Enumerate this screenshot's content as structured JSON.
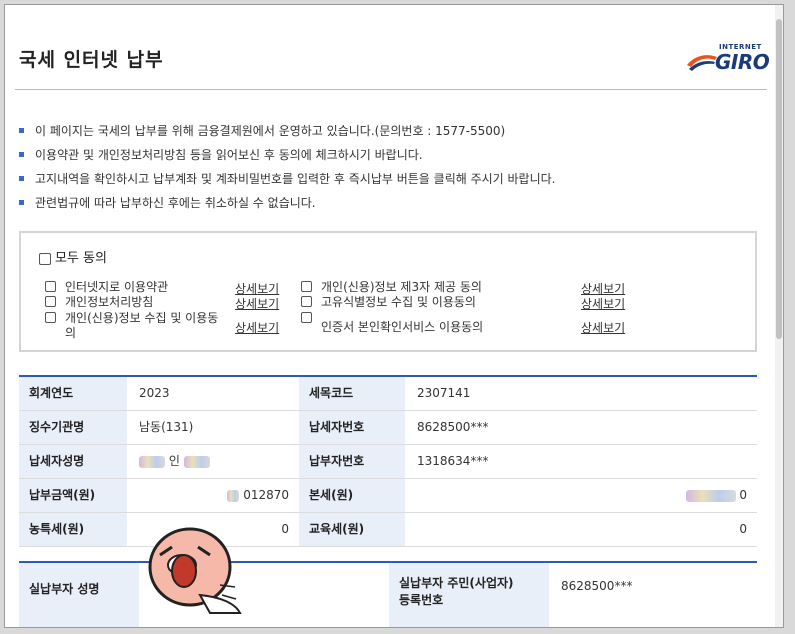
{
  "header": {
    "title": "국세 인터넷 납부",
    "logo_small": "INTERNET",
    "logo_big": "GIRO"
  },
  "notices": [
    "이 페이지는 국세의 납부를 위해 금융결제원에서 운영하고 있습니다.(문의번호 : 1577-5500)",
    "이용약관 및 개인정보처리방침 등을 읽어보신 후 동의에 체크하시기 바랍니다.",
    "고지내역을 확인하시고 납부계좌 및 계좌비밀번호를 입력한 후 즉시납부 버튼을 클릭해 주시기 바랍니다.",
    "관련법규에 따라 납부하신 후에는 취소하실 수 없습니다."
  ],
  "agreements": {
    "all_label": "모두 동의",
    "detail_label": "상세보기",
    "left": [
      "인터넷지로 이용약관",
      "개인정보처리방침",
      "개인(신용)정보 수집 및 이용동의"
    ],
    "right": [
      "개인(신용)정보 제3자 제공 동의",
      "고유식별정보 수집 및 이용동의",
      "인증서 본인확인서비스 이용동의"
    ]
  },
  "bill": {
    "rows": [
      {
        "h1": "회계연도",
        "v1": "2023",
        "h2": "세목코드",
        "v2": "2307141"
      },
      {
        "h1": "징수기관명",
        "v1": "남동(131)",
        "h2": "납세자번호",
        "v2": "8628500***"
      },
      {
        "h1": "납세자성명",
        "v1": "인",
        "h2": "납부자번호",
        "v2": "1318634***"
      },
      {
        "h1": "납부금액(원)",
        "v1": "012870",
        "h2": "본세(원)",
        "v2": "0"
      },
      {
        "h1": "농특세(원)",
        "v1": "0",
        "h2": "교육세(원)",
        "v2": "0"
      }
    ]
  },
  "payer": {
    "name_label": "실납부자 성명",
    "id_label_line1": "실납부자 주민(사업자)",
    "id_label_line2": "등록번호",
    "id_value": "8628500***"
  },
  "colors": {
    "accent": "#2b5bb5",
    "header_cell_bg": "#e8eff9",
    "bullet": "#3a6ac8"
  }
}
